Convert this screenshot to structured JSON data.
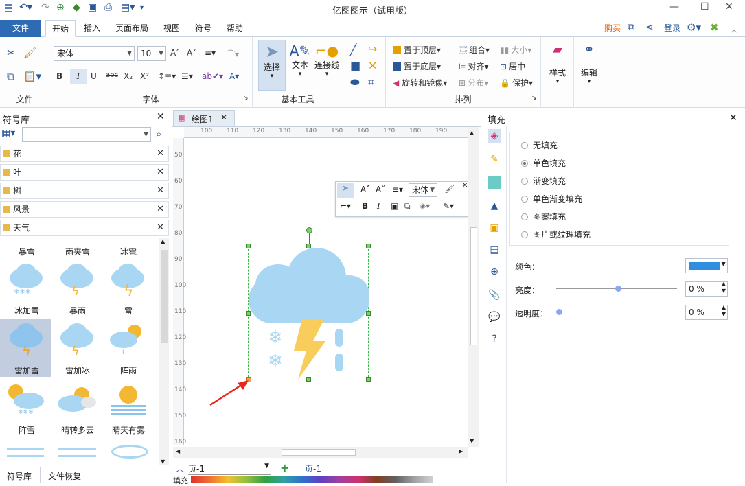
{
  "app": {
    "title": "亿图图示（试用版）"
  },
  "menu": {
    "file": "文件",
    "tabs": [
      "开始",
      "插入",
      "页面布局",
      "视图",
      "符号",
      "帮助"
    ],
    "buy": "购买",
    "login": "登录"
  },
  "ribbon": {
    "groups": {
      "file": "文件",
      "font": "字体",
      "basic_tools": "基本工具",
      "arrange": "排列"
    },
    "font_name": "宋体",
    "font_size": "10",
    "select": "选择",
    "text": "文本",
    "connector": "连接线",
    "bring_front": "置于顶层",
    "send_back": "置于底层",
    "rotate_mirror": "旋转和镜像",
    "group": "组合",
    "align": "对齐",
    "distribute": "分布",
    "size": "大小",
    "center": "居中",
    "protect": "保护",
    "style": "样式",
    "edit": "编辑"
  },
  "library": {
    "title": "符号库",
    "search_placeholder": "",
    "categories": [
      "花",
      "叶",
      "树",
      "风景",
      "天气"
    ],
    "symbols": [
      "暴雪",
      "雨夹雪",
      "冰雹",
      "冰加雪",
      "暴雨",
      "雷",
      "雷加雪",
      "雷加冰",
      "阵雨",
      "阵雪",
      "晴转多云",
      "晴天有雾"
    ],
    "tabs": [
      "符号库",
      "文件恢复"
    ]
  },
  "document": {
    "tab": "绘图1",
    "ruler_h": [
      "100",
      "110",
      "120",
      "130",
      "140",
      "150",
      "160",
      "170",
      "180",
      "190"
    ],
    "ruler_v": [
      "50",
      "60",
      "70",
      "80",
      "90",
      "100",
      "110",
      "120",
      "130",
      "140",
      "150",
      "160"
    ],
    "mini_font": "宋体",
    "page_selector": "页-1",
    "page_tab": "页-1",
    "fill_label": "填充"
  },
  "fill_panel": {
    "title": "填充",
    "options": [
      "无填充",
      "单色填充",
      "渐变填充",
      "单色渐变填充",
      "图案填充",
      "图片或纹理填充"
    ],
    "selected": 1,
    "color_label": "颜色：",
    "brightness_label": "亮度：",
    "brightness_value": "0 %",
    "transparency_label": "透明度：",
    "transparency_value": "0 %",
    "color_value": "#2f8fde"
  }
}
